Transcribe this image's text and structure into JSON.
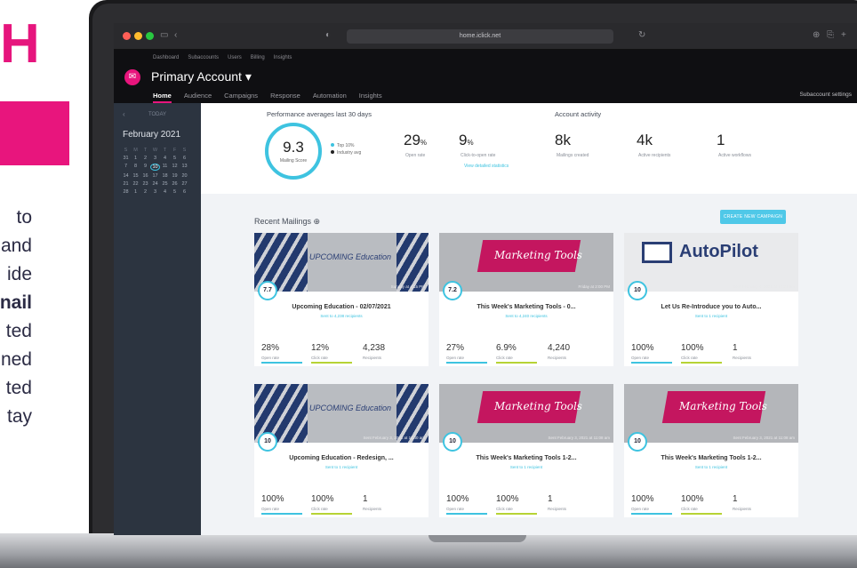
{
  "marketing": {
    "heading_fragment": "H",
    "lines": [
      "to",
      "and",
      "ide",
      "nail",
      "ted",
      "ned",
      "ted",
      "tay"
    ]
  },
  "browser": {
    "url": "home.iclick.net"
  },
  "header": {
    "top_links": [
      "Dashboard",
      "Subaccounts",
      "Users",
      "Billing",
      "Insights"
    ],
    "account_name": "Primary Account ▾",
    "nav_tabs": [
      "Home",
      "Audience",
      "Campaigns",
      "Response",
      "Automation",
      "Insights"
    ],
    "subaccount_settings": "Subaccount settings"
  },
  "sidebar": {
    "today_label": "TODAY",
    "month": "February 2021",
    "weekdays": [
      "S",
      "M",
      "T",
      "W",
      "T",
      "F",
      "S"
    ],
    "days": [
      "31",
      "1",
      "2",
      "3",
      "4",
      "5",
      "6",
      "7",
      "8",
      "9",
      "10",
      "11",
      "12",
      "13",
      "14",
      "15",
      "16",
      "17",
      "18",
      "19",
      "20",
      "21",
      "22",
      "23",
      "24",
      "25",
      "26",
      "27",
      "28",
      "1",
      "2",
      "3",
      "4",
      "5",
      "6"
    ],
    "selected_day": "10"
  },
  "performance": {
    "title": "Performance averages last 30 days",
    "mailing_score": "9.3",
    "mailing_score_label": "Mailing Score",
    "legend": [
      "Top 10%",
      "Industry avg"
    ],
    "open_rate": "29",
    "open_rate_label": "Open rate",
    "click_rate": "9",
    "click_rate_label": "Click-to-open rate",
    "link_text": "View detailed statistics",
    "percent_sign": "%"
  },
  "account_activity": {
    "title": "Account activity",
    "items": [
      {
        "value": "8k",
        "label": "Mailings created"
      },
      {
        "value": "4k",
        "label": "Active recipients"
      },
      {
        "value": "1",
        "label": "Active workflows"
      }
    ]
  },
  "recent_mailings": {
    "title": "Recent Mailings ⊕",
    "create_button": "CREATE NEW CAMPAIGN",
    "cards": [
      {
        "image": "edu",
        "image_text": "UPCOMING Education",
        "date": "Sunday at 4:15 PM",
        "score": "7.7",
        "title": "Upcoming Education - 02/07/2021",
        "subtitle": "Sent to 4,238 recipients",
        "stats": [
          "28%",
          "12%",
          "4,238"
        ],
        "stat_labels": [
          "Open rate",
          "Click rate",
          "Recipients"
        ]
      },
      {
        "image": "mkt",
        "image_text": "Marketing Tools",
        "date": "Friday at 2:00 PM",
        "score": "7.2",
        "title": "This Week's Marketing Tools - 0...",
        "subtitle": "Sent to 4,240 recipients",
        "stats": [
          "27%",
          "6.9%",
          "4,240"
        ],
        "stat_labels": [
          "Open rate",
          "Click rate",
          "Recipients"
        ]
      },
      {
        "image": "ap",
        "image_text": "AutoPilot",
        "date": "Sent February 4, 2021 at 10:21 am",
        "score": "10",
        "title": "Let Us Re-Introduce you to Auto...",
        "subtitle": "Sent to 1 recipient",
        "stats": [
          "100%",
          "100%",
          "1"
        ],
        "stat_labels": [
          "Open rate",
          "Click rate",
          "Recipients"
        ]
      },
      {
        "image": "edu",
        "image_text": "UPCOMING Education",
        "date": "Sent February 3, 2021 at 11:40 am",
        "score": "10",
        "title": "Upcoming Education - Redesign, ...",
        "subtitle": "Sent to 1 recipient",
        "stats": [
          "100%",
          "100%",
          "1"
        ],
        "stat_labels": [
          "Open rate",
          "Click rate",
          "Recipients"
        ]
      },
      {
        "image": "mkt",
        "image_text": "Marketing Tools",
        "date": "Sent February 3, 2021 at 11:08 am",
        "score": "10",
        "title": "This Week's Marketing Tools 1-2...",
        "subtitle": "Sent to 1 recipient",
        "stats": [
          "100%",
          "100%",
          "1"
        ],
        "stat_labels": [
          "Open rate",
          "Click rate",
          "Recipients"
        ]
      },
      {
        "image": "mkt",
        "image_text": "Marketing Tools",
        "date": "Sent February 3, 2021 at 11:08 am",
        "score": "10",
        "title": "This Week's Marketing Tools 1-2...",
        "subtitle": "Sent to 1 recipient",
        "stats": [
          "100%",
          "100%",
          "1"
        ],
        "stat_labels": [
          "Open rate",
          "Click rate",
          "Recipients"
        ]
      }
    ]
  },
  "colors": {
    "brand_pink": "#e8157d",
    "accent_cyan": "#3ec3e0",
    "dark_bg": "#0f0f12",
    "sidebar_bg": "#2c3440"
  }
}
